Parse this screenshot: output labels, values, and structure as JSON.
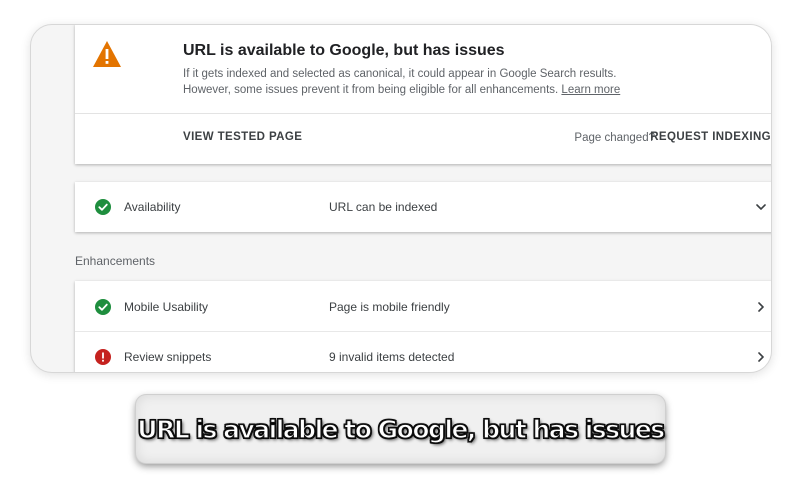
{
  "status_card": {
    "icon": "warning-triangle-icon",
    "title": "URL is available to Google, but has issues",
    "description_line1": "If it gets indexed and selected as canonical, it could appear in Google Search results.",
    "description_line2": "However, some issues prevent it from being eligible for all enhancements.",
    "learn_more": "Learn more",
    "view_tested_page": "VIEW TESTED PAGE",
    "page_changed": "Page changed?",
    "request_indexing": "REQUEST INDEXING"
  },
  "availability": {
    "icon": "check-circle-icon",
    "label": "Availability",
    "value": "URL can be indexed",
    "chevron": "chevron-down-icon"
  },
  "enhancements": {
    "heading": "Enhancements",
    "items": [
      {
        "icon": "check-circle-icon",
        "label": "Mobile Usability",
        "value": "Page is mobile friendly",
        "chevron": "chevron-right-icon"
      },
      {
        "icon": "error-circle-icon",
        "label": "Review snippets",
        "value": "9 invalid items detected",
        "chevron": "chevron-right-icon"
      }
    ]
  },
  "caption": {
    "text": "URL is available to Google, but has issues"
  },
  "colors": {
    "warning": "#e37400",
    "success": "#1e8e3e",
    "error": "#c5221f"
  }
}
